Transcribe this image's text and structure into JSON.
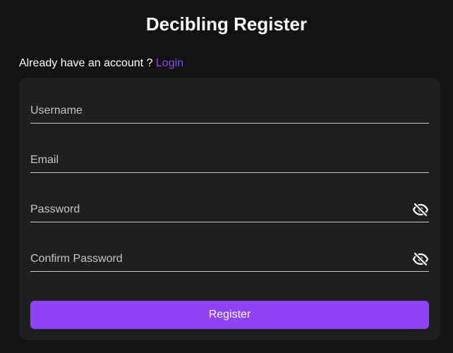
{
  "header": {
    "title": "Decibling Register"
  },
  "account_prompt": {
    "text": "Already have an account ? ",
    "login_label": "Login"
  },
  "form": {
    "username": {
      "placeholder": "Username",
      "value": ""
    },
    "email": {
      "placeholder": "Email",
      "value": ""
    },
    "password": {
      "placeholder": "Password",
      "value": "",
      "toggle_icon": "eye-slash-icon"
    },
    "confirm_password": {
      "placeholder": "Confirm Password",
      "value": "",
      "toggle_icon": "eye-slash-icon"
    },
    "submit_label": "Register"
  },
  "colors": {
    "background": "#121212",
    "card": "#1f1f21",
    "accent": "#8e44f5",
    "text": "#ffffff",
    "placeholder": "#c4c4c8"
  }
}
